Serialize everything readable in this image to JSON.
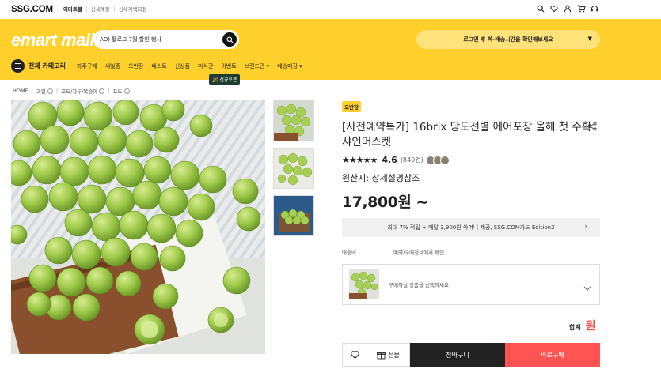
{
  "topbar": {
    "logo": "SSG.COM",
    "links": [
      "이마트몰",
      "신세계몰",
      "신세계백화점"
    ]
  },
  "header": {
    "logo": "emart mall",
    "search_text": "AD) 펩로그 7월 할인 행사",
    "login_text": "로그인 후 쓱-배송시간을 확인해보세요",
    "menu_all": "전체 카테고리",
    "menu_items": [
      "자주구매",
      "세일중",
      "오반장",
      "베스트",
      "신상품",
      "미식관",
      "이벤트",
      "브랜드관 ▾",
      "배송매장 ▾"
    ],
    "new_badge": "🎉 신규오픈"
  },
  "breadcrumbs": [
    "HOME",
    "과일",
    "포도/자두/복숭아",
    "포도"
  ],
  "product": {
    "badge": "오반장",
    "title": "[사전예약특가] 16brix 당도선별 에어포장 올해 첫 수확 샤인머스켓",
    "stars": "★★★★★",
    "score": "4.6",
    "reviews": "(840건)",
    "origin": "원산지: 상세설명참조",
    "price": "17,800원 ~",
    "promo": "최대 7% 적립 + 매달 3,900원 쓱머니 제공, SSG.COM카드 Edition2",
    "shipping_label": "배송비",
    "shipping_value": "예약/구매정보에서 확인",
    "option_text": "구매하실 상품을 선택하세요",
    "total_label": "합계",
    "total_value": "원"
  },
  "buttons": {
    "gift": "선물",
    "cart": "장바구니",
    "buy": "바로구매"
  },
  "colors": {
    "brand_yellow": "#ffd02b",
    "buy_red": "#ff5452",
    "cart_black": "#222222"
  }
}
